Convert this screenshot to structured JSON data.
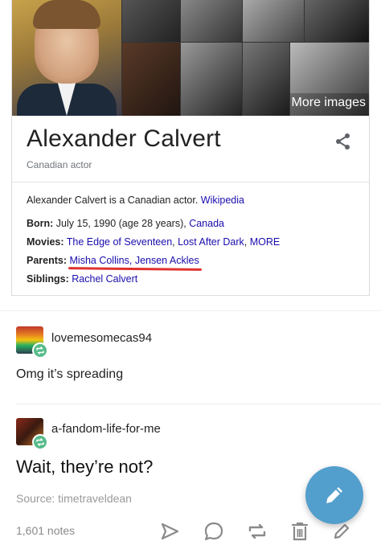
{
  "panel": {
    "more_images_label": "More images",
    "name": "Alexander Calvert",
    "subtitle": "Canadian actor",
    "description_text": "Alexander Calvert is a Canadian actor. ",
    "description_source": "Wikipedia",
    "born": {
      "label": "Born:",
      "text": " July 15, 1990 (age 28 years), ",
      "place": "Canada"
    },
    "movies": {
      "label": "Movies:",
      "items": [
        "The Edge of Seventeen",
        "Lost After Dark",
        "MORE"
      ]
    },
    "parents": {
      "label": "Parents:",
      "items": [
        "Misha Collins",
        "Jensen Ackles"
      ]
    },
    "siblings": {
      "label": "Siblings:",
      "items": [
        "Rachel Calvert"
      ]
    },
    "icons": {
      "share": "share-icon"
    }
  },
  "posts": [
    {
      "username": "lovemesomecas94",
      "body": "Omg it’s spreading"
    },
    {
      "username": "a-fandom-life-for-me",
      "body": "Wait, they’re not?"
    }
  ],
  "source_label": "Source: timetraveldean",
  "notes": "1,601 notes",
  "colors": {
    "link": "#1a0dab",
    "underline": "#e0322e",
    "reblog_green": "#56bc8a",
    "fab_blue": "#529ecc"
  }
}
